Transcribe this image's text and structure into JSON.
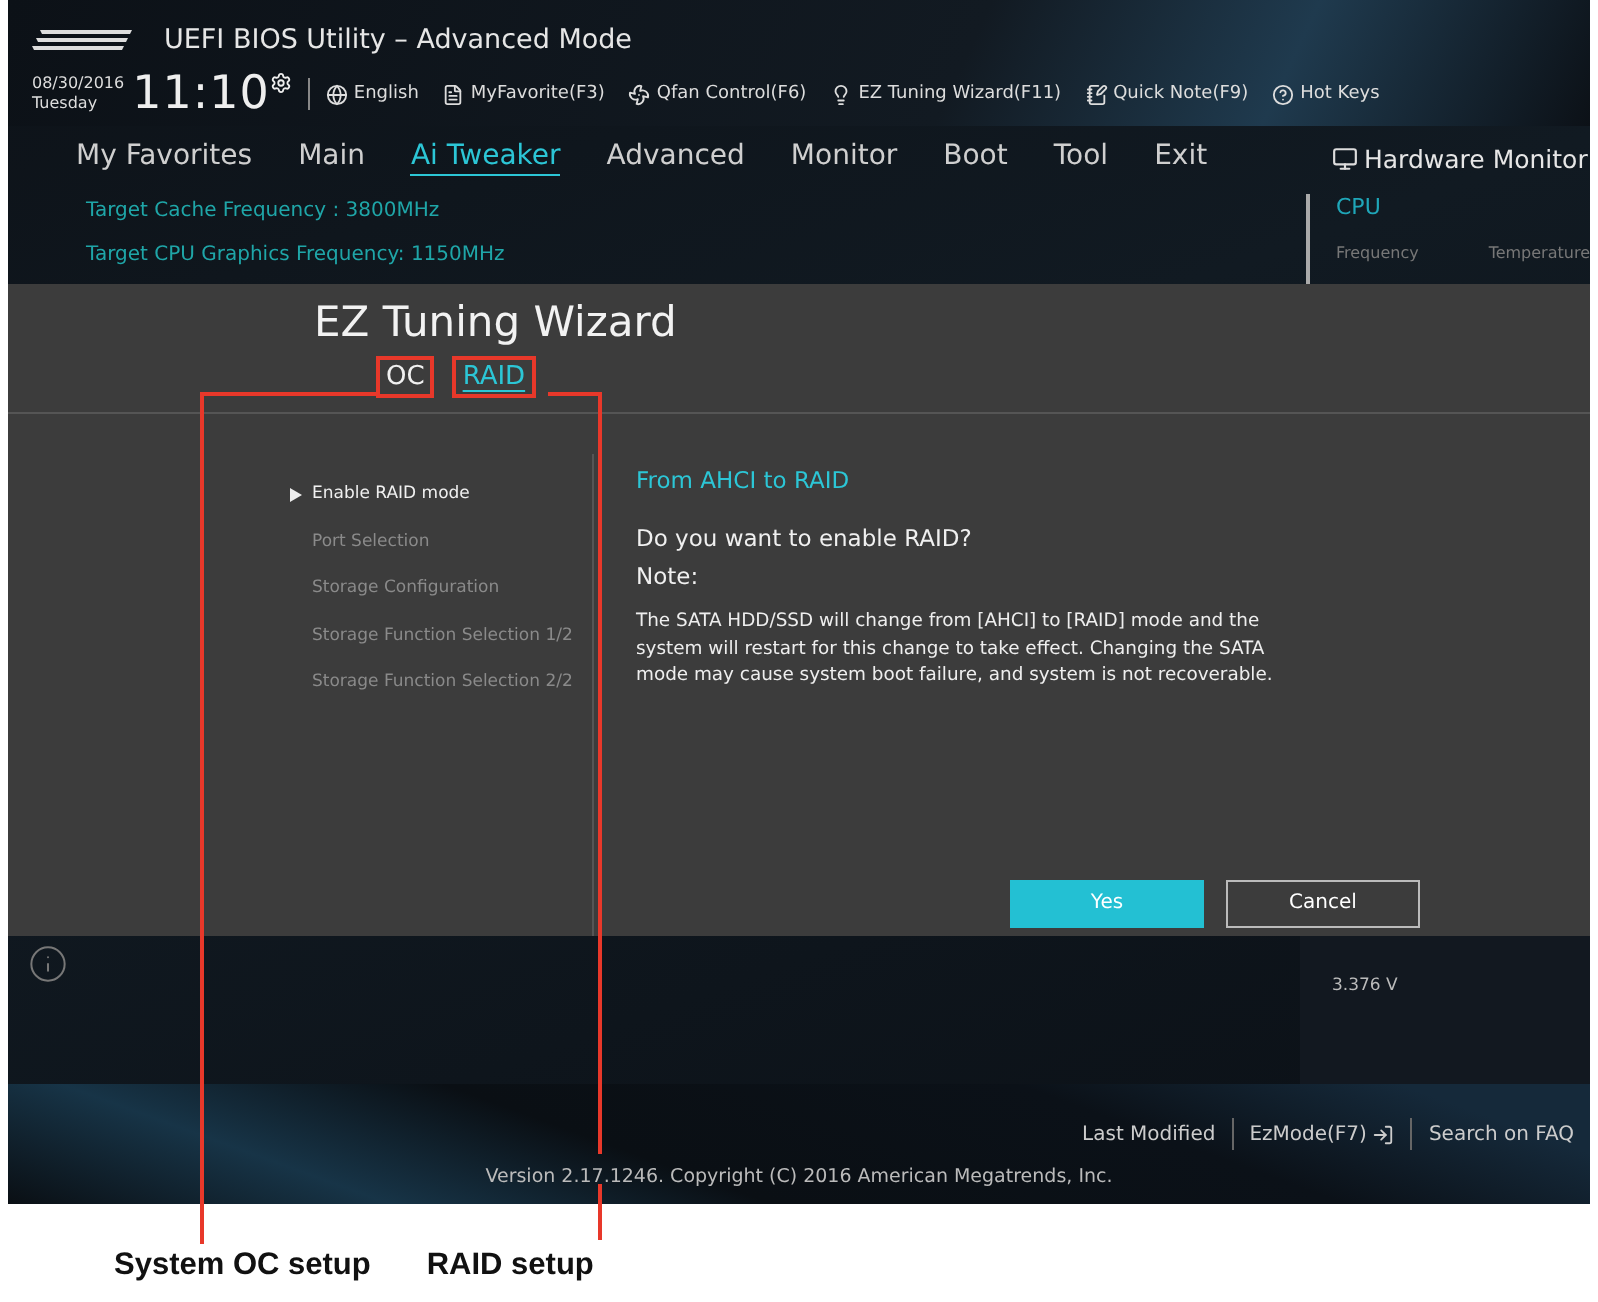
{
  "header": {
    "title": "UEFI BIOS Utility – Advanced Mode",
    "date": "08/30/2016",
    "day": "Tuesday",
    "time": "11:10",
    "toolbar": [
      {
        "label": "English"
      },
      {
        "label": "MyFavorite(F3)"
      },
      {
        "label": "Qfan Control(F6)"
      },
      {
        "label": "EZ Tuning Wizard(F11)"
      },
      {
        "label": "Quick Note(F9)"
      },
      {
        "label": "Hot Keys"
      }
    ]
  },
  "nav": {
    "tabs": [
      {
        "label": "My Favorites",
        "selected": false
      },
      {
        "label": "Main",
        "selected": false
      },
      {
        "label": "Ai Tweaker",
        "selected": true
      },
      {
        "label": "Advanced",
        "selected": false
      },
      {
        "label": "Monitor",
        "selected": false
      },
      {
        "label": "Boot",
        "selected": false
      },
      {
        "label": "Tool",
        "selected": false
      },
      {
        "label": "Exit",
        "selected": false
      }
    ],
    "hardware_monitor": "Hardware Monitor"
  },
  "settings": [
    "Target Cache Frequency : 3800MHz",
    "Target CPU Graphics Frequency: 1150MHz"
  ],
  "monitor": {
    "section": "CPU",
    "columns": [
      "Frequency",
      "Temperature"
    ],
    "reading": "3.376 V"
  },
  "wizard": {
    "title": "EZ Tuning Wizard",
    "tabs": [
      {
        "label": "OC",
        "selected": false
      },
      {
        "label": "RAID",
        "selected": true
      }
    ],
    "steps": [
      {
        "label": "Enable RAID mode",
        "selected": true
      },
      {
        "label": "Port Selection",
        "selected": false
      },
      {
        "label": "Storage Configuration",
        "selected": false
      },
      {
        "label": "Storage Function Selection 1/2",
        "selected": false
      },
      {
        "label": "Storage Function Selection 2/2",
        "selected": false
      }
    ],
    "heading": "From AHCI to RAID",
    "question": "Do you want to enable RAID?",
    "note_label": "Note:",
    "note": "The SATA HDD/SSD will change from [AHCI] to [RAID] mode and the system will restart for this change to take effect. Changing the SATA mode may cause system boot failure, and system is not recoverable.",
    "buttons": [
      {
        "label": "Yes",
        "kind": "primary"
      },
      {
        "label": "Cancel",
        "kind": "secondary"
      }
    ]
  },
  "footer": {
    "links": [
      "Last Modified",
      "EzMode(F7)",
      "Search on FAQ"
    ],
    "version": "Version 2.17.1246. Copyright (C) 2016 American Megatrends, Inc."
  },
  "callouts": [
    {
      "label": "System OC setup"
    },
    {
      "label": "RAID setup"
    }
  ]
}
